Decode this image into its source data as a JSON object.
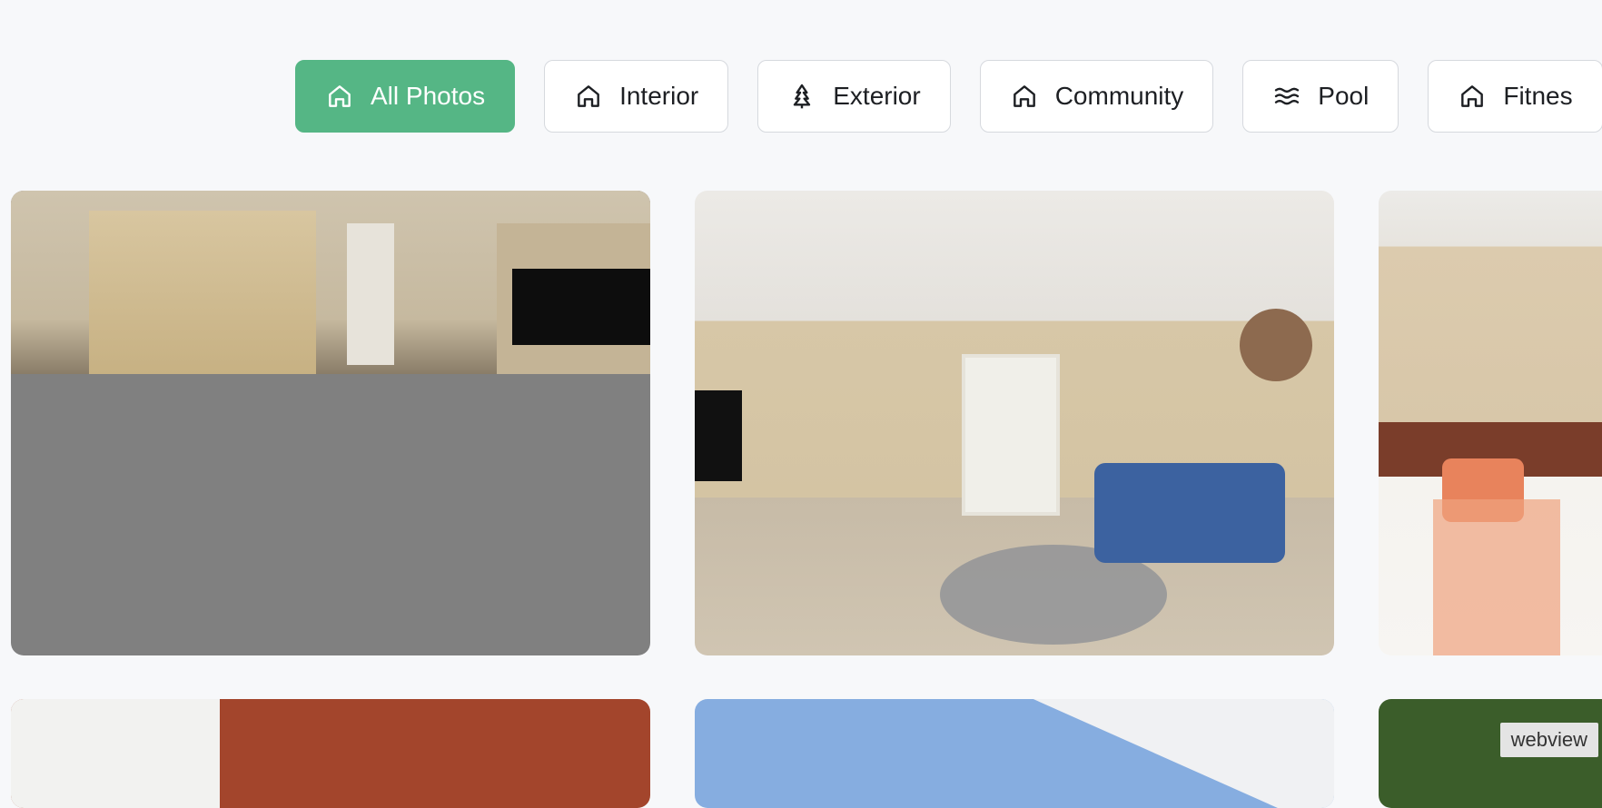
{
  "filters": [
    {
      "label": "All Photos",
      "icon": "home-icon",
      "active": true
    },
    {
      "label": "Interior",
      "icon": "home-icon",
      "active": false
    },
    {
      "label": "Exterior",
      "icon": "tree-icon",
      "active": false
    },
    {
      "label": "Community",
      "icon": "home-icon",
      "active": false
    },
    {
      "label": "Pool",
      "icon": "waves-icon",
      "active": false
    },
    {
      "label": "Fitnes",
      "icon": "home-icon",
      "active": false
    }
  ],
  "gallery": {
    "photos": [
      {
        "name": "photo-living-dining"
      },
      {
        "name": "photo-living-room"
      },
      {
        "name": "photo-bedroom"
      },
      {
        "name": "photo-patio"
      },
      {
        "name": "photo-pool-pergola"
      },
      {
        "name": "photo-trees"
      }
    ]
  },
  "badge": {
    "label": "webview"
  },
  "colors": {
    "accent": "#55b685",
    "background": "#f7f8fa",
    "placeholder": "#808080"
  }
}
